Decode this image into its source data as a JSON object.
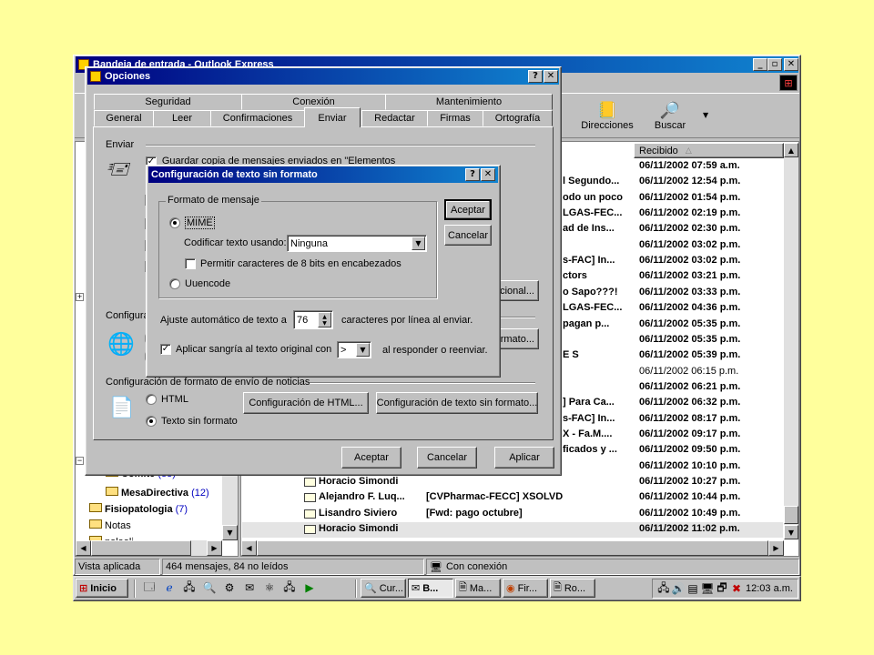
{
  "outlook": {
    "title": "Bandeja de entrada - Outlook Express",
    "toolbar": {
      "direcciones": "Direcciones",
      "buscar": "Buscar"
    },
    "list_header": {
      "recibido": "Recibido",
      "sort_indicator": "△"
    },
    "rows": [
      {
        "from": "",
        "subject": "",
        "date": "06/11/2002 07:59 a.m."
      },
      {
        "from": "",
        "subject": "l Segundo...",
        "date": "06/11/2002 12:54 p.m."
      },
      {
        "from": "",
        "subject": "odo un poco",
        "date": "06/11/2002 01:54 p.m."
      },
      {
        "from": "",
        "subject": "LGAS-FEC...",
        "date": "06/11/2002 02:19 p.m."
      },
      {
        "from": "",
        "subject": "ad de Ins...",
        "date": "06/11/2002 02:30 p.m."
      },
      {
        "from": "",
        "subject": "",
        "date": "06/11/2002 03:02 p.m."
      },
      {
        "from": "",
        "subject": "s-FAC] In...",
        "date": "06/11/2002 03:02 p.m."
      },
      {
        "from": "",
        "subject": "ctors",
        "date": "06/11/2002 03:21 p.m."
      },
      {
        "from": "",
        "subject": "o Sapo???!",
        "date": "06/11/2002 03:33 p.m."
      },
      {
        "from": "",
        "subject": "LGAS-FEC...",
        "date": "06/11/2002 04:36 p.m."
      },
      {
        "from": "",
        "subject": "pagan p...",
        "date": "06/11/2002 05:35 p.m."
      },
      {
        "from": "",
        "subject": "",
        "date": "06/11/2002 05:35 p.m."
      },
      {
        "from": "",
        "subject": "E S",
        "date": "06/11/2002 05:39 p.m."
      },
      {
        "from": "",
        "subject": "",
        "date": "06/11/2002 06:15 p.m."
      },
      {
        "from": "",
        "subject": "",
        "date": "06/11/2002 06:21 p.m."
      },
      {
        "from": "",
        "subject": "] Para Ca...",
        "date": "06/11/2002 06:32 p.m."
      },
      {
        "from": "",
        "subject": "s-FAC] In...",
        "date": "06/11/2002 08:17 p.m."
      },
      {
        "from": "",
        "subject": "X - Fa.M....",
        "date": "06/11/2002 09:17 p.m."
      },
      {
        "from": "",
        "subject": "ficados y ...",
        "date": "06/11/2002 09:50 p.m."
      },
      {
        "from": "",
        "subject": "",
        "date": "06/11/2002 10:10 p.m."
      },
      {
        "from": "Horacio Simondi",
        "subject": "",
        "date": "06/11/2002 10:27 p.m."
      },
      {
        "from": "Alejandro F. Luq...",
        "subject": "[CVPharmac-FECC] XSOLVD",
        "date": "06/11/2002 10:44 p.m."
      },
      {
        "from": "Lisandro Siviero",
        "subject": "[Fwd: pago octubre]",
        "date": "06/11/2002 10:49 p.m."
      },
      {
        "from": "Horacio Simondi",
        "subject": "",
        "date": "06/11/2002 11:02 p.m."
      }
    ],
    "folders": [
      {
        "name": "Comite",
        "count": "(83)"
      },
      {
        "name": "MesaDirectiva",
        "count": "(12)"
      },
      {
        "name": "Fisiopatologia",
        "count": "(7)"
      },
      {
        "name": "Notas",
        "count": ""
      },
      {
        "name": "palaoli",
        "count": ""
      }
    ],
    "status": {
      "view": "Vista aplicada",
      "messages": "464 mensajes, 84 no leídos",
      "connection": "Con conexión"
    }
  },
  "opciones": {
    "title": "Opciones",
    "tabs_back": [
      "Seguridad",
      "Conexión",
      "Mantenimiento"
    ],
    "tabs_front": [
      "General",
      "Leer",
      "Confirmaciones",
      "Enviar",
      "Redactar",
      "Firmas",
      "Ortografía"
    ],
    "section_enviar": "Enviar",
    "guardar_copia": "Guardar copia de mensajes enviados en \"Elementos enviados\"",
    "section_config_partial": "Configura",
    "btn_internacional_partial": "cional...",
    "btn_formato_partial": "rmato...",
    "news_section": "Configuración de formato de envío de noticias",
    "html_label": "HTML",
    "texto_sin_formato": "Texto sin formato",
    "btn_config_html": "Configuración de HTML...",
    "btn_config_texto": "Configuración de texto sin formato...",
    "btn_aceptar": "Aceptar",
    "btn_cancelar": "Cancelar",
    "btn_aplicar": "Aplicar"
  },
  "config": {
    "title": "Configuración de texto sin formato",
    "group_label": "Formato de mensaje",
    "mime": "MIME",
    "codificar_label": "Codificar texto usando:",
    "codificar_value": "Ninguna",
    "permitir": "Permitir caracteres de 8 bits en encabezados",
    "uuencode": "Uuencode",
    "ajuste_label": "Ajuste automático de texto a",
    "ajuste_value": "76",
    "ajuste_suffix": "caracteres por línea al enviar.",
    "sangria_label": "Aplicar sangría al texto original con",
    "sangria_value": ">",
    "sangria_suffix": "al responder o reenviar.",
    "btn_aceptar": "Aceptar",
    "btn_cancelar": "Cancelar"
  },
  "taskbar": {
    "start": "Inicio",
    "tasks": [
      "Cur...",
      "B...",
      "Ma...",
      "Fir...",
      "Ro..."
    ],
    "clock": "12:03 a.m."
  }
}
